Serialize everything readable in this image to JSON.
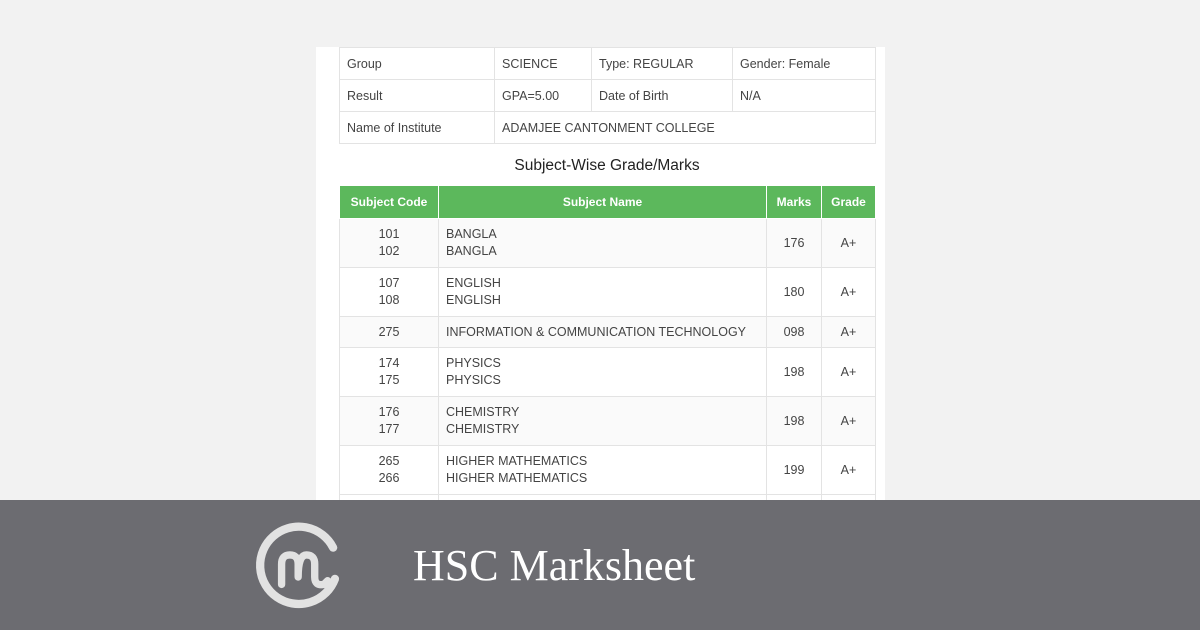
{
  "info": {
    "rows": [
      [
        "Group",
        "SCIENCE",
        "Type: REGULAR",
        "Gender: Female"
      ],
      [
        "Result",
        "GPA=5.00",
        "Date of Birth",
        "N/A"
      ],
      [
        "Name of Institute",
        "ADAMJEE CANTONMENT COLLEGE"
      ]
    ]
  },
  "marks": {
    "title": "Subject-Wise Grade/Marks",
    "headers": [
      "Subject Code",
      "Subject Name",
      "Marks",
      "Grade"
    ],
    "rows": [
      {
        "codes": [
          "101",
          "102"
        ],
        "names": [
          "BANGLA",
          "BANGLA"
        ],
        "marks": "176",
        "grade": "A+"
      },
      {
        "codes": [
          "107",
          "108"
        ],
        "names": [
          "ENGLISH",
          "ENGLISH"
        ],
        "marks": "180",
        "grade": "A+"
      },
      {
        "codes": [
          "275"
        ],
        "names": [
          "INFORMATION & COMMUNICATION TECHNOLOGY"
        ],
        "marks": "098",
        "grade": "A+"
      },
      {
        "codes": [
          "174",
          "175"
        ],
        "names": [
          "PHYSICS",
          "PHYSICS"
        ],
        "marks": "198",
        "grade": "A+"
      },
      {
        "codes": [
          "176",
          "177"
        ],
        "names": [
          "CHEMISTRY",
          "CHEMISTRY"
        ],
        "marks": "198",
        "grade": "A+"
      },
      {
        "codes": [
          "265",
          "266"
        ],
        "names": [
          "HIGHER MATHEMATICS",
          "HIGHER MATHEMATICS"
        ],
        "marks": "199",
        "grade": "A+"
      }
    ]
  },
  "banner": {
    "title": "HSC Marksheet",
    "logo_icon": "coinmarketcap-style-m-logo",
    "background": "#6c6c71"
  },
  "colors": {
    "header_green": "#5cb85c"
  }
}
